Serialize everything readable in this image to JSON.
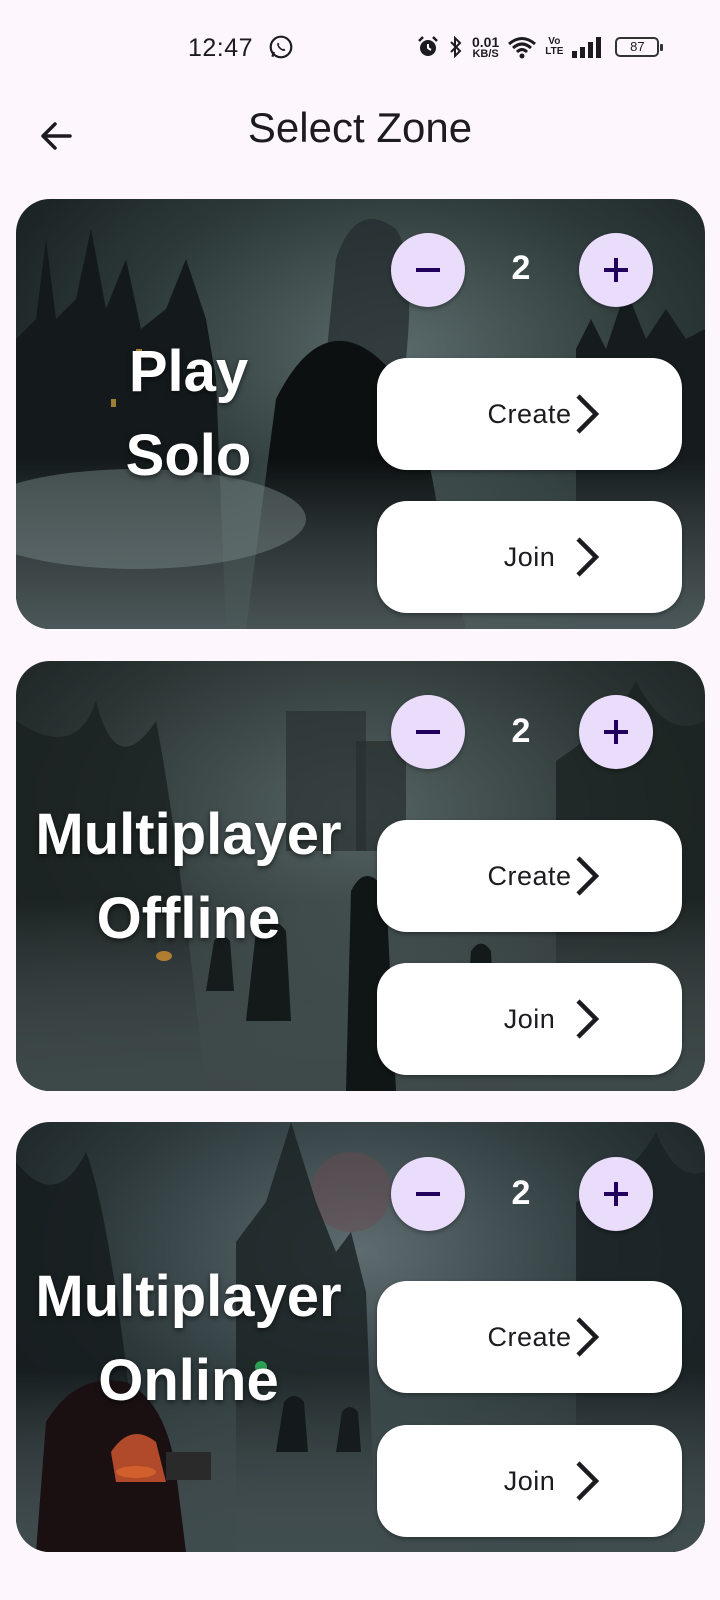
{
  "status_bar": {
    "time": "12:47",
    "net_speed_value": "0.01",
    "net_speed_unit": "KB/S",
    "volte_top": "Vo",
    "volte_bottom": "LTE",
    "battery": "87",
    "icons": [
      "whatsapp-icon",
      "alarm-icon",
      "bluetooth-icon",
      "wifi-icon",
      "signal-icon",
      "battery-icon"
    ]
  },
  "header": {
    "title": "Select Zone",
    "back_icon": "arrow-left-icon"
  },
  "zones": [
    {
      "label_line1": "Play",
      "label_line2": "Solo",
      "count": "2",
      "create_label": "Create",
      "join_label": "Join"
    },
    {
      "label_line1": "Multiplayer",
      "label_line2": "Offline",
      "count": "2",
      "create_label": "Create",
      "join_label": "Join"
    },
    {
      "label_line1": "Multiplayer",
      "label_line2": "Online",
      "count": "2",
      "create_label": "Create",
      "join_label": "Join"
    }
  ],
  "colors": {
    "background": "#fdf6fd",
    "stepper_button": "#eadcfb",
    "stepper_icon": "#21005d",
    "action_button": "#ffffff"
  }
}
